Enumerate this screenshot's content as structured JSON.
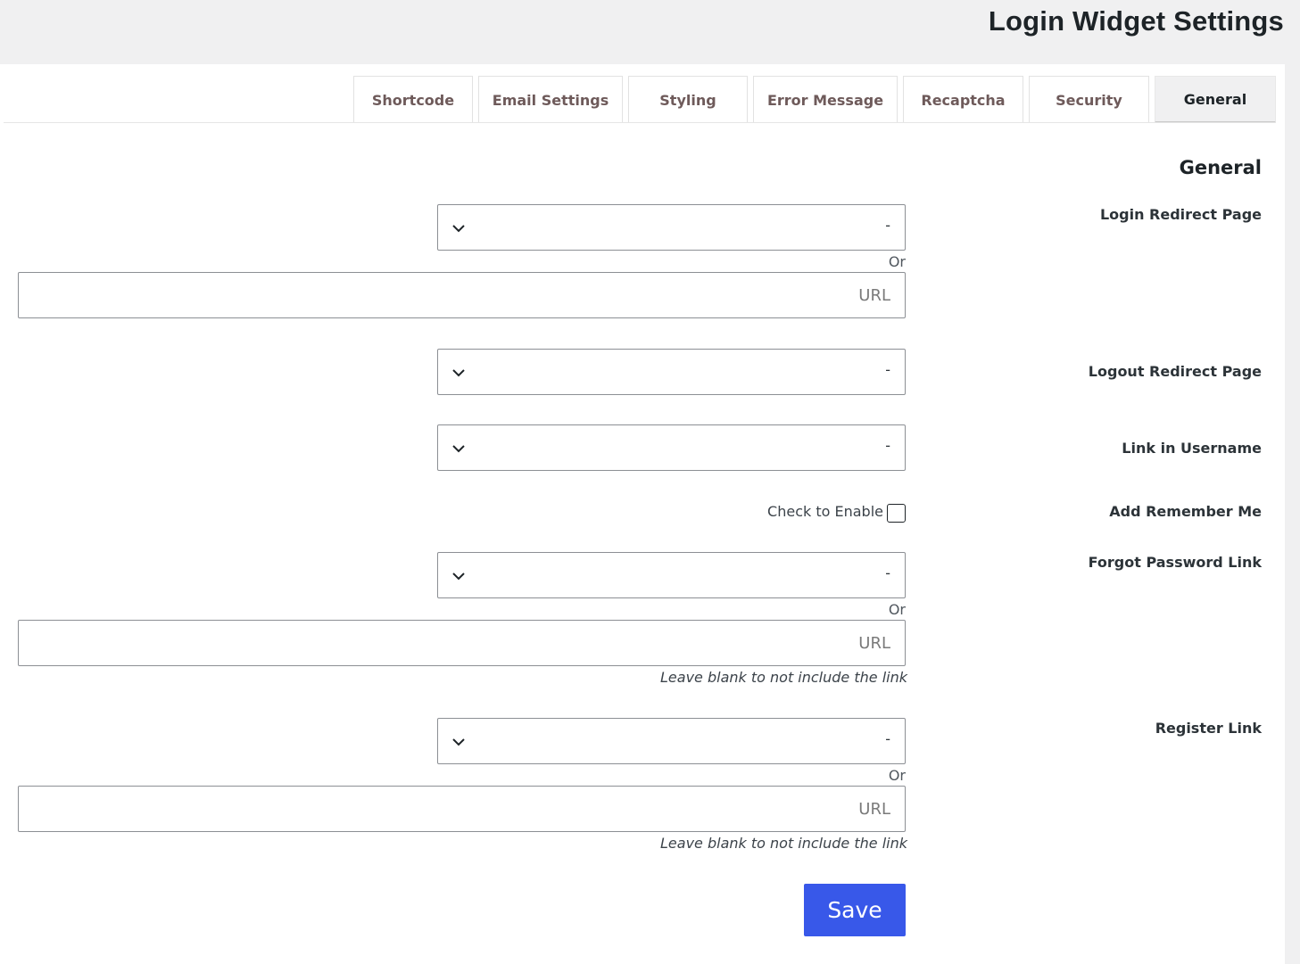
{
  "header": {
    "title": "Login Widget Settings"
  },
  "tabs": [
    {
      "label": "Shortcode"
    },
    {
      "label": "Email Settings"
    },
    {
      "label": "Styling"
    },
    {
      "label": "Error Message"
    },
    {
      "label": "Recaptcha"
    },
    {
      "label": "Security"
    },
    {
      "label": "General",
      "active": true
    }
  ],
  "section": {
    "title": "General"
  },
  "fields": {
    "login_redirect": {
      "label": "Login Redirect Page",
      "select_value": "-",
      "or_text": "Or",
      "url_placeholder": "URL"
    },
    "logout_redirect": {
      "label": "Logout Redirect Page",
      "select_value": "-"
    },
    "link_in_username": {
      "label": "Link in Username",
      "select_value": "-"
    },
    "remember_me": {
      "label": "Add Remember Me",
      "checkbox_label": "Check to Enable",
      "checked": false
    },
    "forgot_password": {
      "label": "Forgot Password Link",
      "select_value": "-",
      "or_text": "Or",
      "url_placeholder": "URL",
      "hint": "Leave blank to not include the link"
    },
    "register_link": {
      "label": "Register Link",
      "select_value": "-",
      "or_text": "Or",
      "url_placeholder": "URL",
      "hint": "Leave blank to not include the link"
    }
  },
  "actions": {
    "save_label": "Save"
  },
  "colors": {
    "accent": "#3858e9",
    "tab_text": "#6e5a5a",
    "background": "#f0f0f1"
  },
  "icons": {
    "select_arrow": "chevron-down-icon"
  }
}
